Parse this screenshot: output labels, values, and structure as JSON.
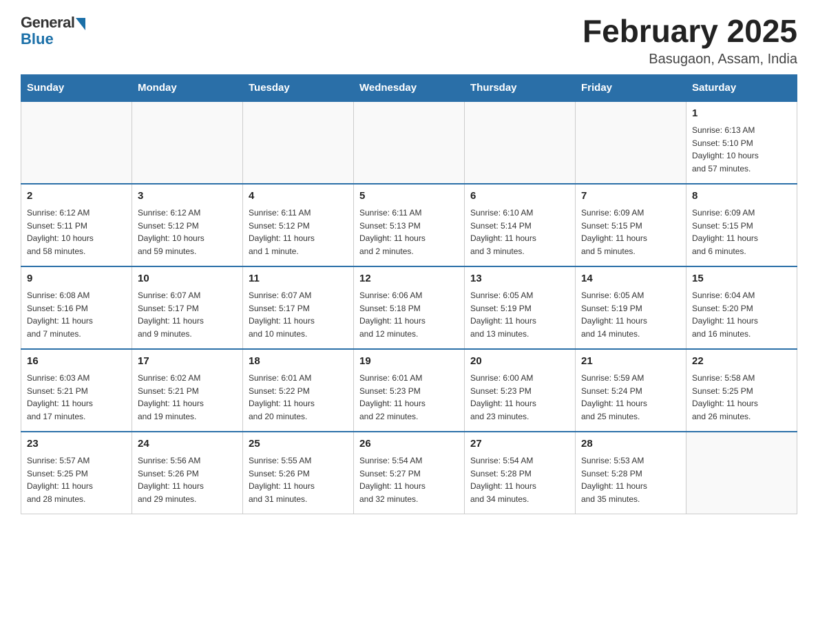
{
  "header": {
    "logo_general": "General",
    "logo_blue": "Blue",
    "month_title": "February 2025",
    "location": "Basugaon, Assam, India"
  },
  "days_of_week": [
    "Sunday",
    "Monday",
    "Tuesday",
    "Wednesday",
    "Thursday",
    "Friday",
    "Saturday"
  ],
  "weeks": [
    [
      {
        "day": "",
        "info": ""
      },
      {
        "day": "",
        "info": ""
      },
      {
        "day": "",
        "info": ""
      },
      {
        "day": "",
        "info": ""
      },
      {
        "day": "",
        "info": ""
      },
      {
        "day": "",
        "info": ""
      },
      {
        "day": "1",
        "info": "Sunrise: 6:13 AM\nSunset: 5:10 PM\nDaylight: 10 hours\nand 57 minutes."
      }
    ],
    [
      {
        "day": "2",
        "info": "Sunrise: 6:12 AM\nSunset: 5:11 PM\nDaylight: 10 hours\nand 58 minutes."
      },
      {
        "day": "3",
        "info": "Sunrise: 6:12 AM\nSunset: 5:12 PM\nDaylight: 10 hours\nand 59 minutes."
      },
      {
        "day": "4",
        "info": "Sunrise: 6:11 AM\nSunset: 5:12 PM\nDaylight: 11 hours\nand 1 minute."
      },
      {
        "day": "5",
        "info": "Sunrise: 6:11 AM\nSunset: 5:13 PM\nDaylight: 11 hours\nand 2 minutes."
      },
      {
        "day": "6",
        "info": "Sunrise: 6:10 AM\nSunset: 5:14 PM\nDaylight: 11 hours\nand 3 minutes."
      },
      {
        "day": "7",
        "info": "Sunrise: 6:09 AM\nSunset: 5:15 PM\nDaylight: 11 hours\nand 5 minutes."
      },
      {
        "day": "8",
        "info": "Sunrise: 6:09 AM\nSunset: 5:15 PM\nDaylight: 11 hours\nand 6 minutes."
      }
    ],
    [
      {
        "day": "9",
        "info": "Sunrise: 6:08 AM\nSunset: 5:16 PM\nDaylight: 11 hours\nand 7 minutes."
      },
      {
        "day": "10",
        "info": "Sunrise: 6:07 AM\nSunset: 5:17 PM\nDaylight: 11 hours\nand 9 minutes."
      },
      {
        "day": "11",
        "info": "Sunrise: 6:07 AM\nSunset: 5:17 PM\nDaylight: 11 hours\nand 10 minutes."
      },
      {
        "day": "12",
        "info": "Sunrise: 6:06 AM\nSunset: 5:18 PM\nDaylight: 11 hours\nand 12 minutes."
      },
      {
        "day": "13",
        "info": "Sunrise: 6:05 AM\nSunset: 5:19 PM\nDaylight: 11 hours\nand 13 minutes."
      },
      {
        "day": "14",
        "info": "Sunrise: 6:05 AM\nSunset: 5:19 PM\nDaylight: 11 hours\nand 14 minutes."
      },
      {
        "day": "15",
        "info": "Sunrise: 6:04 AM\nSunset: 5:20 PM\nDaylight: 11 hours\nand 16 minutes."
      }
    ],
    [
      {
        "day": "16",
        "info": "Sunrise: 6:03 AM\nSunset: 5:21 PM\nDaylight: 11 hours\nand 17 minutes."
      },
      {
        "day": "17",
        "info": "Sunrise: 6:02 AM\nSunset: 5:21 PM\nDaylight: 11 hours\nand 19 minutes."
      },
      {
        "day": "18",
        "info": "Sunrise: 6:01 AM\nSunset: 5:22 PM\nDaylight: 11 hours\nand 20 minutes."
      },
      {
        "day": "19",
        "info": "Sunrise: 6:01 AM\nSunset: 5:23 PM\nDaylight: 11 hours\nand 22 minutes."
      },
      {
        "day": "20",
        "info": "Sunrise: 6:00 AM\nSunset: 5:23 PM\nDaylight: 11 hours\nand 23 minutes."
      },
      {
        "day": "21",
        "info": "Sunrise: 5:59 AM\nSunset: 5:24 PM\nDaylight: 11 hours\nand 25 minutes."
      },
      {
        "day": "22",
        "info": "Sunrise: 5:58 AM\nSunset: 5:25 PM\nDaylight: 11 hours\nand 26 minutes."
      }
    ],
    [
      {
        "day": "23",
        "info": "Sunrise: 5:57 AM\nSunset: 5:25 PM\nDaylight: 11 hours\nand 28 minutes."
      },
      {
        "day": "24",
        "info": "Sunrise: 5:56 AM\nSunset: 5:26 PM\nDaylight: 11 hours\nand 29 minutes."
      },
      {
        "day": "25",
        "info": "Sunrise: 5:55 AM\nSunset: 5:26 PM\nDaylight: 11 hours\nand 31 minutes."
      },
      {
        "day": "26",
        "info": "Sunrise: 5:54 AM\nSunset: 5:27 PM\nDaylight: 11 hours\nand 32 minutes."
      },
      {
        "day": "27",
        "info": "Sunrise: 5:54 AM\nSunset: 5:28 PM\nDaylight: 11 hours\nand 34 minutes."
      },
      {
        "day": "28",
        "info": "Sunrise: 5:53 AM\nSunset: 5:28 PM\nDaylight: 11 hours\nand 35 minutes."
      },
      {
        "day": "",
        "info": ""
      }
    ]
  ]
}
